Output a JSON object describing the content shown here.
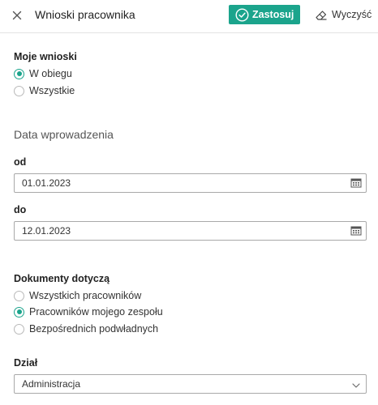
{
  "header": {
    "title": "Wnioski pracownika",
    "apply_label": "Zastosuj",
    "clear_label": "Wyczyść",
    "close_icon": "close-icon",
    "apply_icon": "check-circle-icon",
    "clear_icon": "eraser-icon"
  },
  "colors": {
    "accent": "#1ba48c",
    "divider": "#e3e3e3",
    "input_border": "#a9a9a9"
  },
  "my_requests": {
    "label": "Moje wnioski",
    "options": [
      {
        "label": "W obiegu",
        "checked": true
      },
      {
        "label": "Wszystkie",
        "checked": false
      }
    ]
  },
  "date_entry": {
    "heading": "Data wprowadzenia",
    "from_label": "od",
    "from_value": "01.01.2023",
    "to_label": "do",
    "to_value": "12.01.2023",
    "calendar_icon": "calendar-icon"
  },
  "documents_concern": {
    "label": "Dokumenty dotyczą",
    "options": [
      {
        "label": "Wszystkich pracowników",
        "checked": false
      },
      {
        "label": "Pracowników mojego zespołu",
        "checked": true
      },
      {
        "label": "Bezpośrednich podwładnych",
        "checked": false
      }
    ]
  },
  "department": {
    "label": "Dział",
    "selected": "Administracja",
    "dropdown_icon": "chevron-down-icon"
  }
}
